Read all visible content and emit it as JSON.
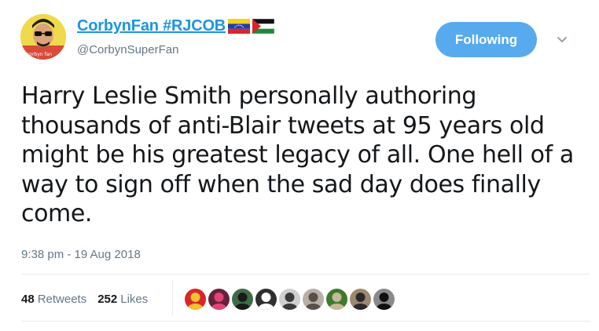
{
  "user": {
    "display_name": "CorbynFan #RJCOB",
    "handle": "@CorbynSuperFan"
  },
  "follow_button": {
    "label": "Following"
  },
  "tweet": {
    "text": "Harry Leslie Smith personally authoring thousands of anti-Blair tweets at 95 years old might be his greatest legacy of all. One hell of a way to sign off when the sad day does finally come.",
    "timestamp": "9:38 pm - 19 Aug 2018"
  },
  "stats": {
    "retweets_count": "48",
    "retweets_label": "Retweets",
    "likes_count": "252",
    "likes_label": "Likes"
  },
  "colors": {
    "link_blue": "#1b95e0",
    "follow_bg": "#56aaed",
    "muted": "#657786",
    "divider": "#e6ecf0"
  },
  "icons": {
    "flags": [
      "venezuela-flag-icon",
      "palestine-flag-icon"
    ],
    "caret": "chevron-down-icon"
  },
  "likers": [
    {
      "name": "liker-avatar-1",
      "bg": "#d9262b",
      "fg": "#f2c230"
    },
    {
      "name": "liker-avatar-2",
      "bg": "#6a1f3a",
      "fg": "#e04575"
    },
    {
      "name": "liker-avatar-3",
      "bg": "#3f6b45",
      "fg": "#1a1a1a"
    },
    {
      "name": "liker-avatar-4",
      "bg": "#2f2f2f",
      "fg": "#ffffff"
    },
    {
      "name": "liker-avatar-5",
      "bg": "#cfcfcf",
      "fg": "#3a3a3a"
    },
    {
      "name": "liker-avatar-6",
      "bg": "#b8b0a6",
      "fg": "#5a4f46"
    },
    {
      "name": "liker-avatar-7",
      "bg": "#3e7a2d",
      "fg": "#c8b89a"
    },
    {
      "name": "liker-avatar-8",
      "bg": "#9b8870",
      "fg": "#2a2a2a"
    },
    {
      "name": "liker-avatar-9",
      "bg": "#8a8a8a",
      "fg": "#111111"
    }
  ]
}
